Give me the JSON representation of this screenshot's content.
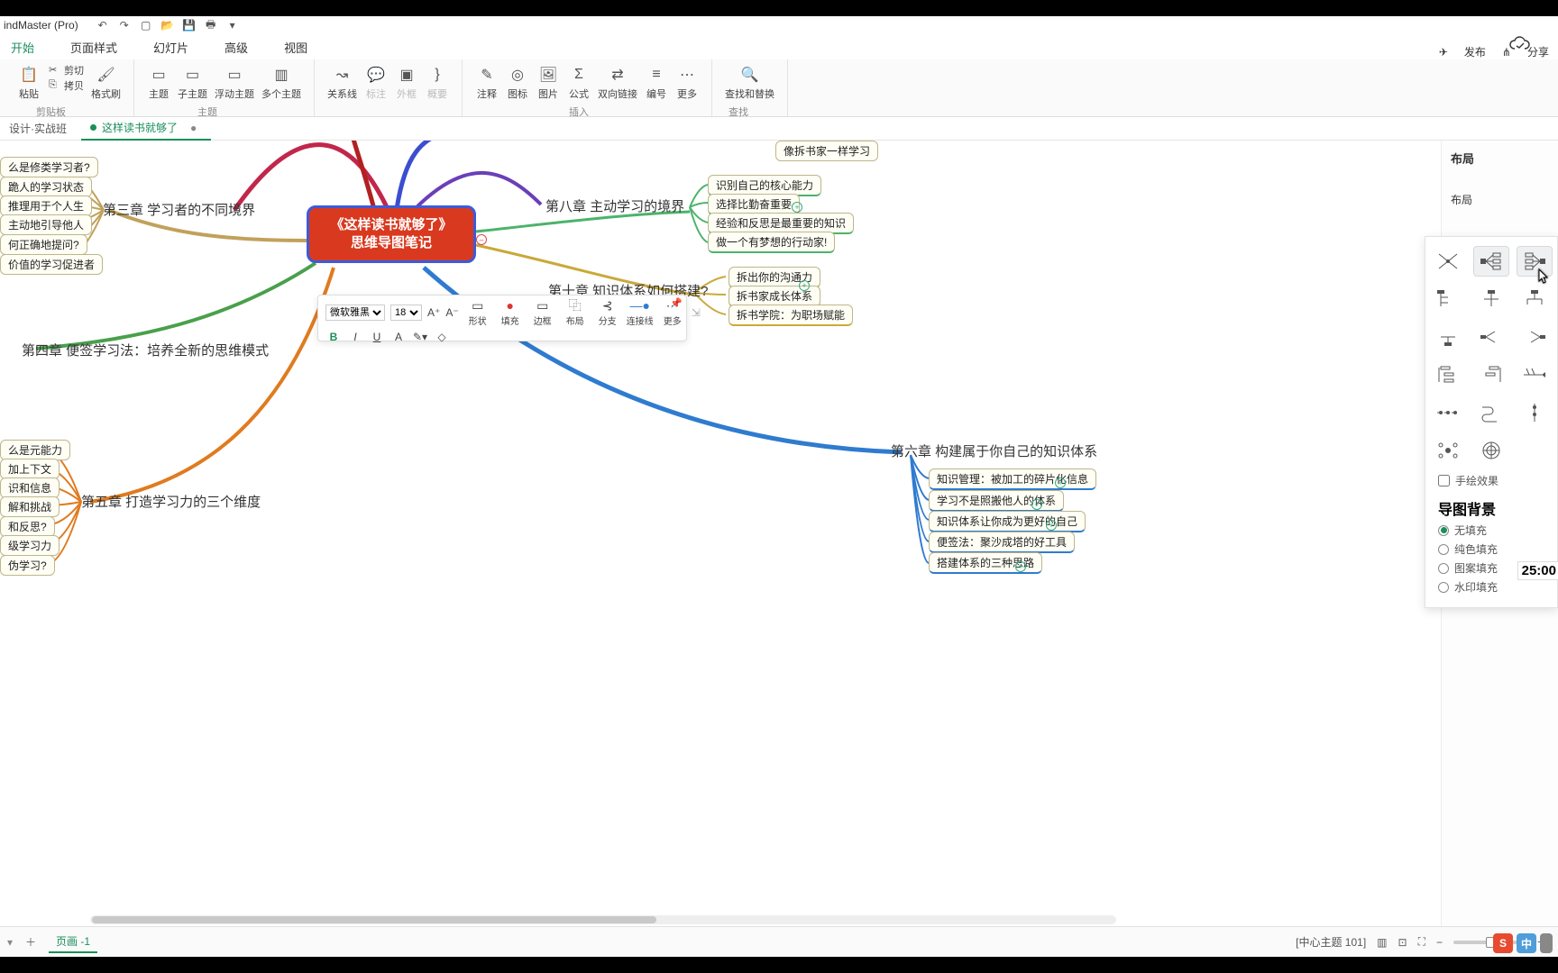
{
  "app": {
    "title": "indMaster (Pro)"
  },
  "menu": {
    "tabs": [
      "开始",
      "页面样式",
      "幻灯片",
      "高级",
      "视图"
    ],
    "right": {
      "publish": "发布",
      "share": "分享"
    }
  },
  "ribbon": {
    "paste": "粘贴",
    "copy": "拷贝",
    "cut": "剪切",
    "fmt": "格式刷",
    "clip_grp": "剪贴板",
    "topic": "主题",
    "sub": "子主题",
    "float": "浮动主题",
    "multi": "多个主题",
    "topic_grp": "主题",
    "rel": "关系线",
    "callout": "标注",
    "frame": "外框",
    "summary": "概要",
    "comment": "注释",
    "marker": "图标",
    "image": "图片",
    "formula": "公式",
    "hyperlink": "双向链接",
    "number": "编号",
    "more": "更多",
    "insert_grp": "插入",
    "find": "查找和替换",
    "find_grp": "查找"
  },
  "docs": {
    "tab1": "设计·实战班",
    "tab2": "这样读书就够了"
  },
  "central": {
    "line1": "《这样读书就够了》",
    "line2": "思维导图笔记"
  },
  "branches": {
    "ch3": "第三章 学习者的不同境界",
    "ch4": "第四章 便签学习法：培养全新的思维模式",
    "ch5": "第五章 打造学习力的三个维度",
    "ch6": "第六章 构建属于你自己的知识体系",
    "ch8": "第八章 主动学习的境界",
    "ch10": "第十章 知识体系如何搭建?",
    "top_r": "像拆书家一样学习"
  },
  "ch3_items": [
    "么是修类学习者?",
    "跪人的学习状态",
    "推理用于个人生",
    "主动地引导他人",
    "何正确地提问?",
    "价值的学习促进者"
  ],
  "ch5_items": [
    "么是元能力",
    "加上下文",
    "识和信息",
    "解和挑战",
    "和反思?",
    "级学习力",
    "伪学习?"
  ],
  "ch6_items": [
    "知识管理：被加工的碎片化信息",
    "学习不是照搬他人的体系",
    "知识体系让你成为更好的自己",
    "便签法：聚沙成塔的好工具",
    "搭建体系的三种思路"
  ],
  "ch8_items": [
    "识别自己的核心能力",
    "选择比勤奋重要",
    "经验和反思是最重要的知识",
    "做一个有梦想的行动家!"
  ],
  "ch10_items": [
    "拆出你的沟通力",
    "拆书家成长体系",
    "拆书学院：为职场赋能"
  ],
  "fbar": {
    "font": "微软雅黑",
    "size": "18",
    "shape": "形状",
    "fill": "填充",
    "border": "边框",
    "layout": "布局",
    "branch": "分支",
    "conn": "连接线",
    "more": "更多"
  },
  "panel": {
    "h1": "布局",
    "sec": "布局",
    "hand": "手绘效果",
    "bg": "导图背景",
    "bg1": "无填充",
    "bg2": "纯色填充",
    "bg3": "图案填充",
    "bg4": "水印填充",
    "timer": "25:00"
  },
  "status": {
    "page": "页画 -1",
    "center": "[中心主题 101]"
  }
}
